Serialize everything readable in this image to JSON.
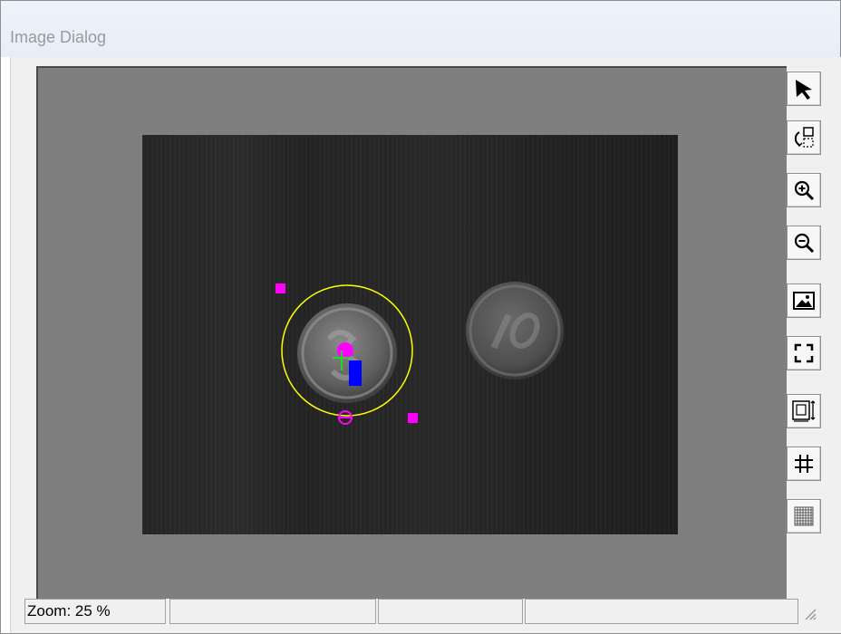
{
  "window": {
    "title": "Image Dialog"
  },
  "toolbar": {
    "items": [
      {
        "name": "pointer-tool-button",
        "icon": "arrow-pointer-icon"
      },
      {
        "name": "rotate-selection-button",
        "icon": "rotate-selection-icon"
      },
      {
        "name": "zoom-in-button",
        "icon": "zoom-in-icon"
      },
      {
        "name": "zoom-out-button",
        "icon": "zoom-out-icon"
      },
      {
        "name": "fit-image-button",
        "icon": "image-icon"
      },
      {
        "name": "full-view-button",
        "icon": "fullscreen-corners-icon"
      },
      {
        "name": "resize-image-button",
        "icon": "resize-frame-icon"
      },
      {
        "name": "grid-button",
        "icon": "grid-icon"
      },
      {
        "name": "pixel-grid-button",
        "icon": "pixel-grid-icon"
      }
    ]
  },
  "status": {
    "zoom": "Zoom: 25 %"
  },
  "colors": {
    "overlay_circle": "#ffff00",
    "overlay_handles": "#ff00ff",
    "marker": "#0000ff",
    "crosshair": "#00ff00"
  }
}
